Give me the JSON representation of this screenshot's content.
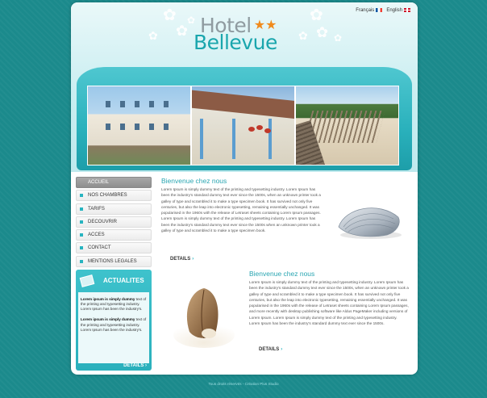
{
  "lang": {
    "french": "Français",
    "english": "English"
  },
  "logo": {
    "hotel": "Hotel",
    "stars": "★★",
    "name": "Bellevue"
  },
  "nav": {
    "items": [
      {
        "label": "ACCUEIL",
        "active": true
      },
      {
        "label": "NOS CHAMBRES",
        "active": false
      },
      {
        "label": "TARIFS",
        "active": false
      },
      {
        "label": "DECOUVRIR",
        "active": false
      },
      {
        "label": "ACCES",
        "active": false
      },
      {
        "label": "CONTACT",
        "active": false
      },
      {
        "label": "MENTIONS LEGALES",
        "active": false
      }
    ]
  },
  "news": {
    "title": "ACTUALITES",
    "items": [
      {
        "title": "Lorem ipsum is simply dummy",
        "text": "text of the printing and typesetting industry. Lorem Ipsum has been the industry's."
      },
      {
        "title": "Lorem ipsum is simply dummy",
        "text": "text of the printing and typesetting industry. Lorem Ipsum has been the industry's."
      }
    ],
    "more": "DETAILS"
  },
  "sections": [
    {
      "title": "Bienvenue chez nous",
      "text": "Lorem Ipsum is simply dummy text of the printing and typesetting industry. Lorem Ipsum has been the industry's standard dummy text ever since the 1500s, when an unknown printer took a galley of type and scrambled it to make a type specimen book. It has survived not only five centuries, but also the leap into electronic typesetting, remaining essentially unchanged. It was popularised in the 1960s with the release of Letraset sheets containing Lorem Ipsum passages. Lorem Ipsum is simply dummy text of the printing and typesetting industry. Lorem Ipsum has been the industry's standard dummy text ever since the 1500s when an unknown printer took a galley of type and scrambled it to make a type specimen book.",
      "details": "DETAILS"
    },
    {
      "title": "Bienvenue chez nous",
      "text": "Lorem Ipsum is simply dummy text of the printing and typesetting industry. Lorem Ipsum has been the industry's standard dummy text ever since the 1500s, when an unknown printer took a galley of type and scrambled it to make a type specimen book. It has survived not only five centuries, but also the leap into electronic typesetting, remaining essentially unchanged. It was popularised in the 1960s with the release of Letraset sheets containing Lorem Ipsum passages, and more recently with desktop publishing software like Aldus PageMaker including versions of Lorem Ipsum. Lorem Ipsum is simply dummy text of the printing and typesetting industry. Lorem Ipsum has been the industry's standard dummy text ever since the 1500s.",
      "details": "DETAILS"
    }
  ],
  "footer": "Tous droits réservés - Création Plus Studio",
  "colors": {
    "background": "#1b8a8c",
    "accent": "#27b4c0",
    "title": "#2aa6b2",
    "star": "#f08a1c"
  }
}
